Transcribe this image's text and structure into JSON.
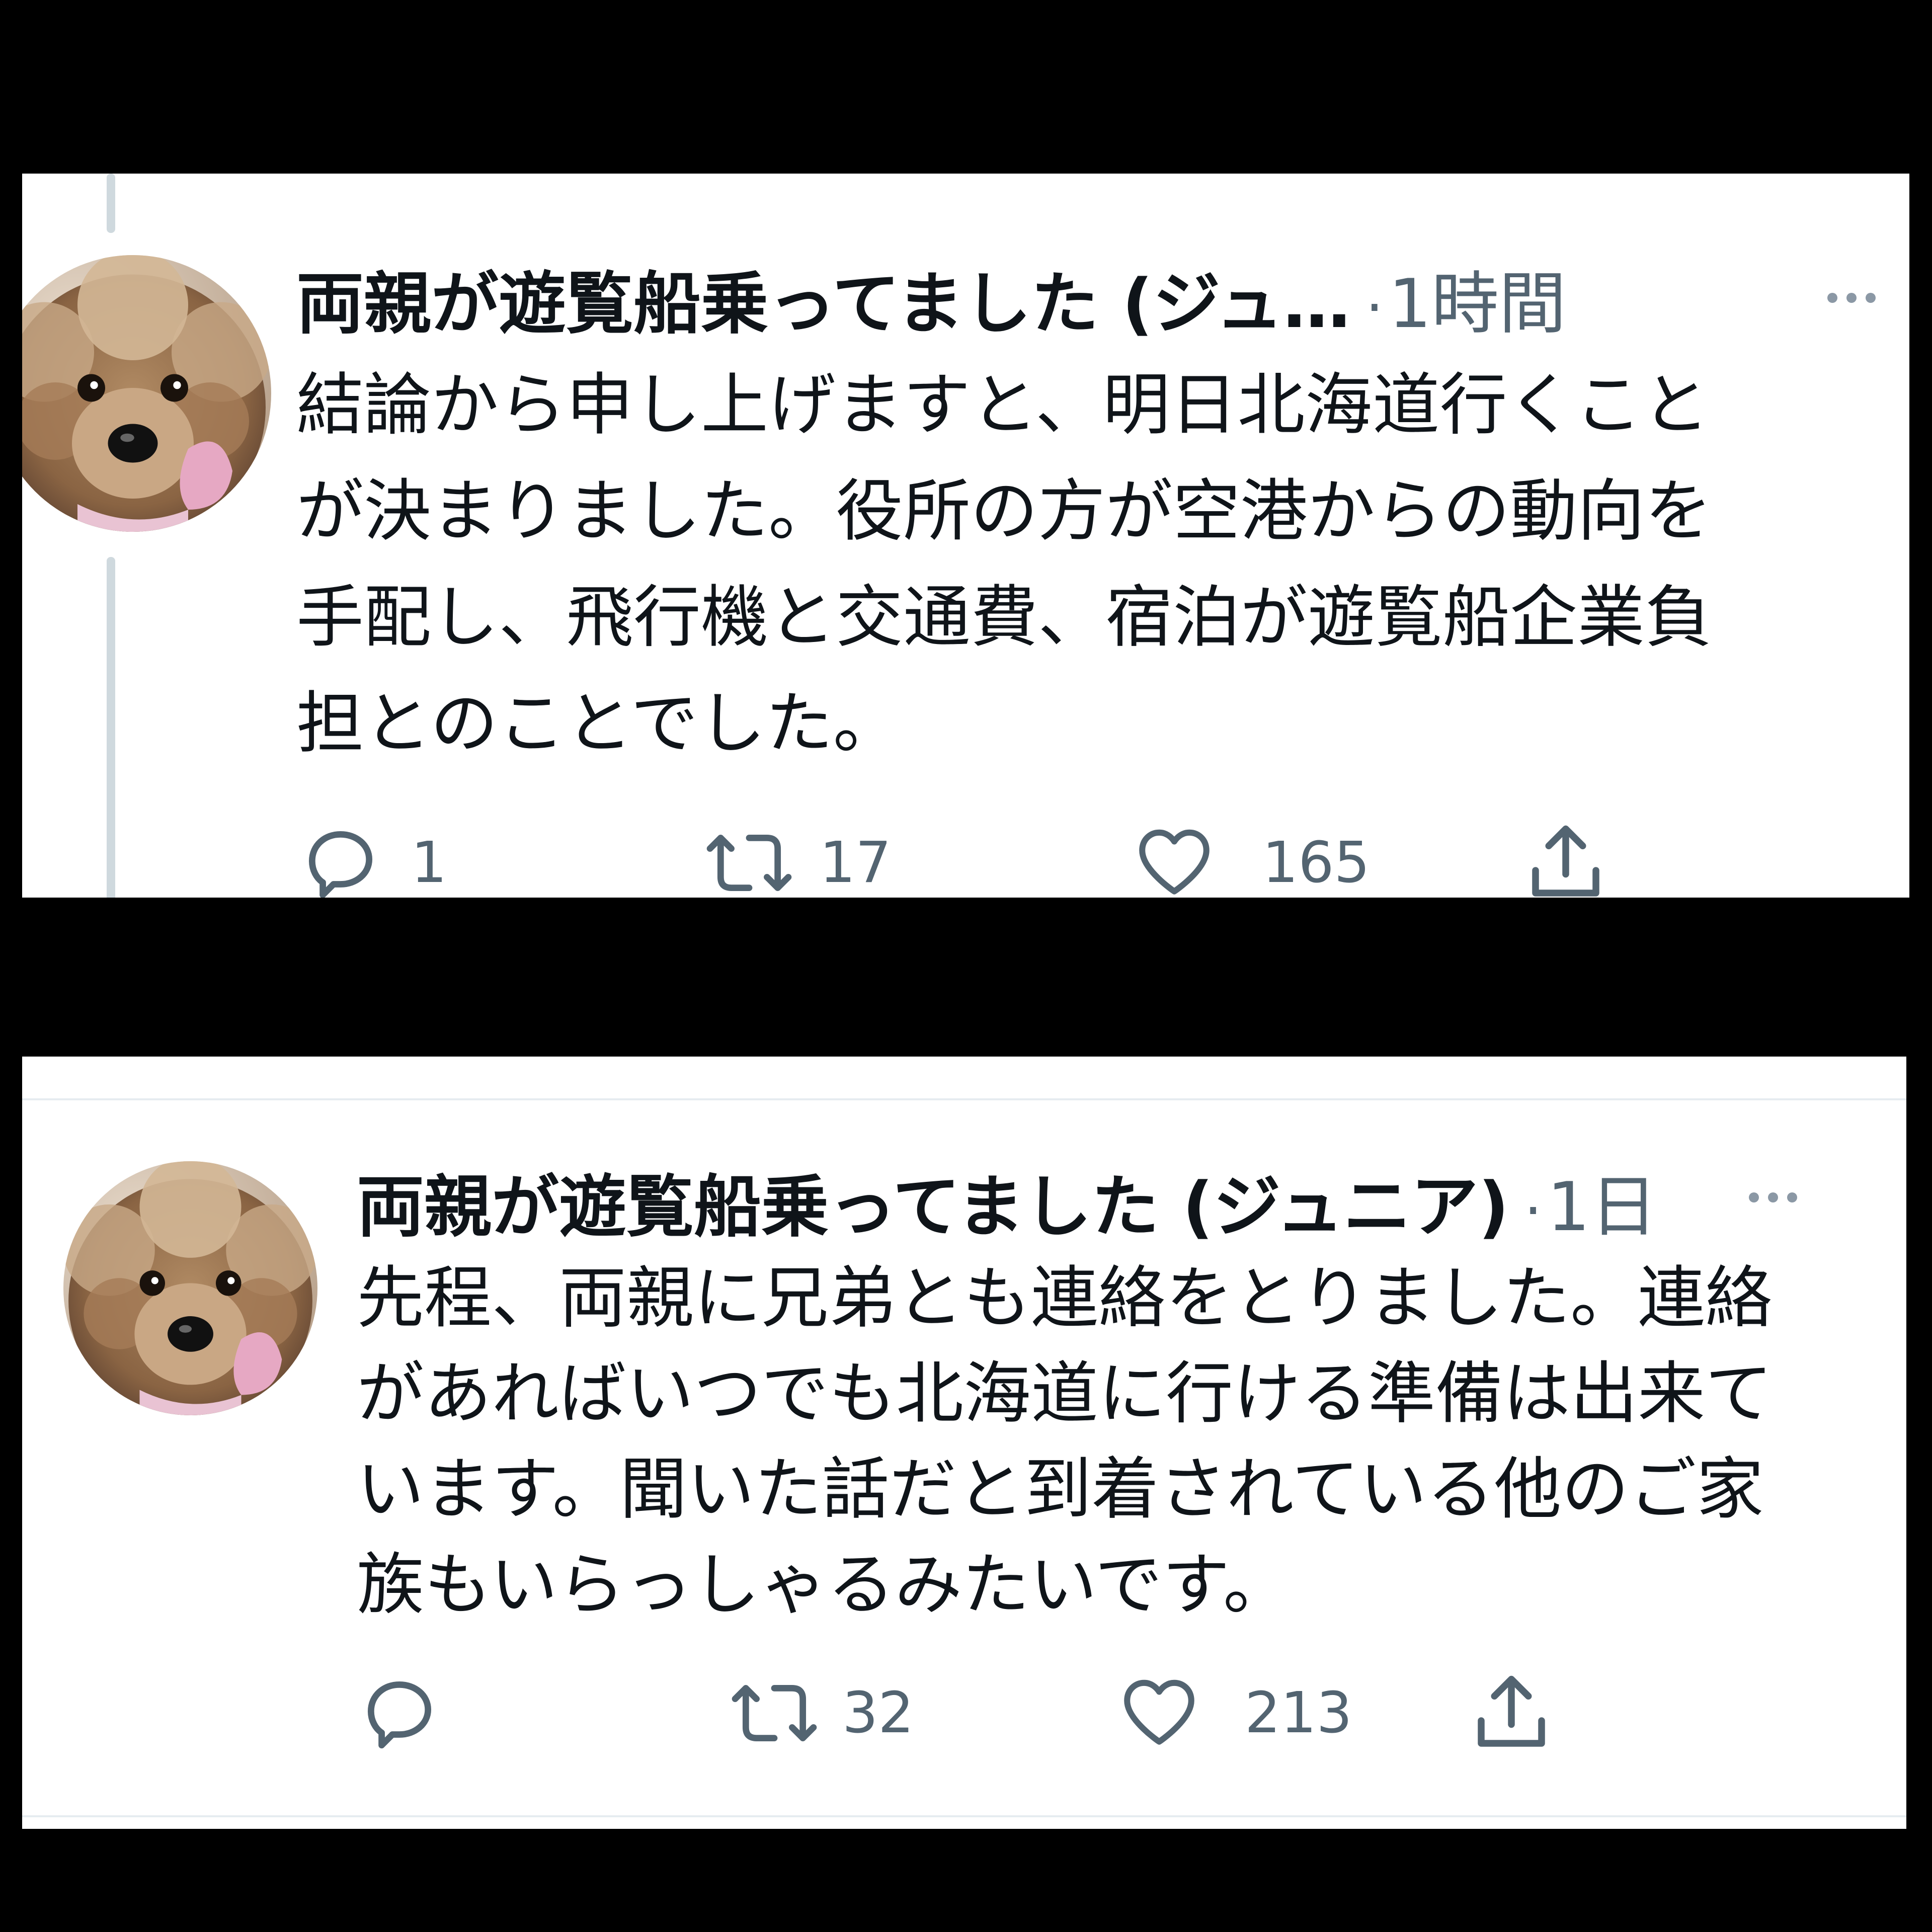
{
  "tweets": [
    {
      "author": "両親が遊覧船乗ってました (ジュ…",
      "separator": "·",
      "time": "1時間",
      "avatar_icon": "poodle-avatar",
      "text_lines": [
        "結論から申し上げますと、明日北海道行くこと",
        "が決まりました。役所の方が空港からの動向を",
        "手配し、飛行機と交通費、宿泊が遊覧船企業負",
        "担とのことでした。"
      ],
      "reply_count": "1",
      "retweet_count": "17",
      "like_count": "165",
      "icons": {
        "reply": "reply-icon",
        "retweet": "retweet-icon",
        "like": "heart-icon",
        "share": "share-icon",
        "more": "more-icon"
      }
    },
    {
      "author": "両親が遊覧船乗ってました (ジュニア)",
      "separator": "·",
      "time": "1日",
      "avatar_icon": "poodle-avatar",
      "text_lines": [
        "先程、両親に兄弟とも連絡をとりました。連絡",
        "があればいつでも北海道に行ける準備は出来て",
        "います。聞いた話だと到着されている他のご家",
        "族もいらっしゃるみたいです。"
      ],
      "reply_count": "",
      "retweet_count": "32",
      "like_count": "213",
      "icons": {
        "reply": "reply-icon",
        "retweet": "retweet-icon",
        "like": "heart-icon",
        "share": "share-icon",
        "more": "more-icon"
      }
    }
  ],
  "colors": {
    "background": "#000000",
    "card": "#ffffff",
    "text": "#0f1419",
    "secondary": "#536471",
    "thread_line": "#cfd9de"
  }
}
